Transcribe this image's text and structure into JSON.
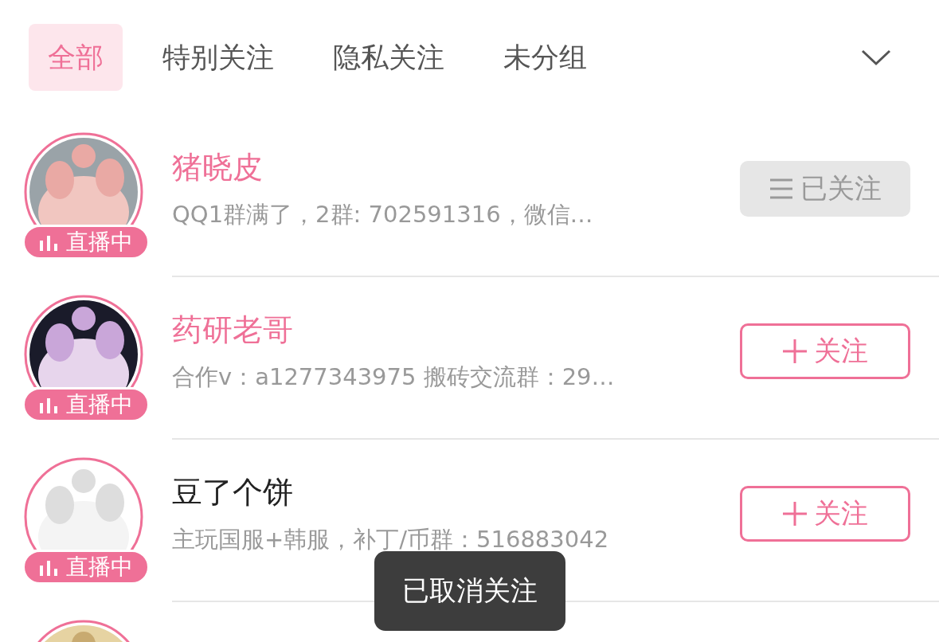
{
  "tabs": [
    {
      "label": "全部",
      "selected": true
    },
    {
      "label": "特别关注",
      "selected": false
    },
    {
      "label": "隐私关注",
      "selected": false
    },
    {
      "label": "未分组",
      "selected": false
    }
  ],
  "rows": [
    {
      "avatar": {
        "kind": "picture"
      },
      "live": true,
      "live_label": "直播中",
      "name": "猪晓皮",
      "highlighted": true,
      "description": "QQ1群满了，2群: 702591316，微信…",
      "followed": true,
      "button_label": "已关注"
    },
    {
      "avatar": {
        "kind": "picture"
      },
      "live": true,
      "live_label": "直播中",
      "name": "药研老哥",
      "highlighted": true,
      "description": "合作v：a1277343975 搬砖交流群：29…",
      "followed": false,
      "button_label": "关注"
    },
    {
      "avatar": {
        "kind": "picture"
      },
      "live": true,
      "live_label": "直播中",
      "name": "豆了个饼",
      "highlighted": false,
      "description": "主玩国服+韩服，补丁/币群：516883042",
      "followed": false,
      "button_label": "关注"
    },
    {
      "avatar": {
        "kind": "picture"
      }
    }
  ],
  "toast": "已取消关注"
}
